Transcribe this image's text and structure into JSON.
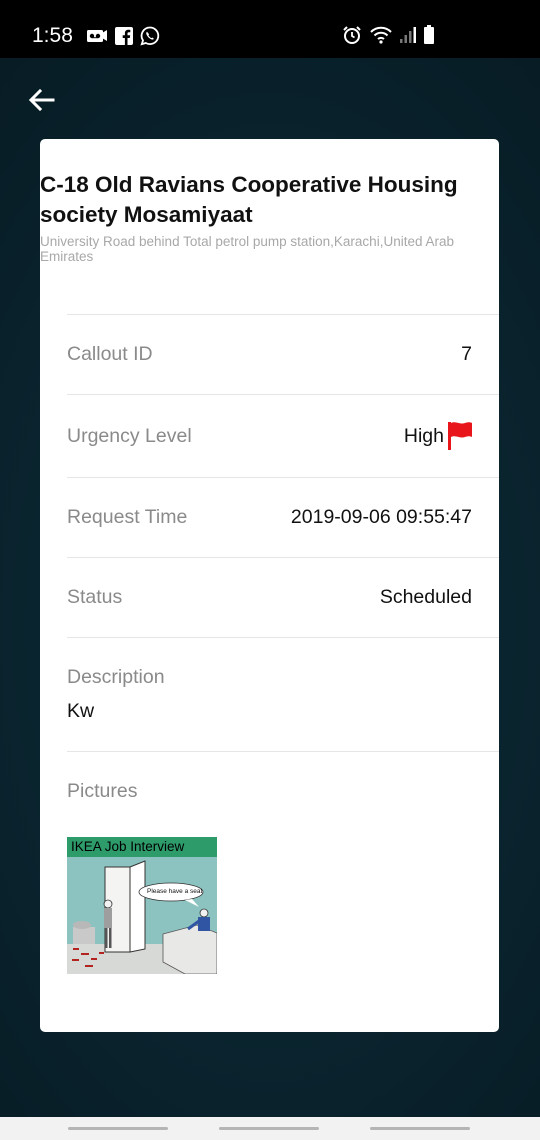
{
  "status_bar": {
    "time": "1:58",
    "left_icons": [
      "voicemail-icon",
      "facebook-icon",
      "whatsapp-icon"
    ],
    "right_icons": [
      "alarm-icon",
      "wifi-icon",
      "signal-icon",
      "battery-icon"
    ]
  },
  "header": {
    "back_icon": "arrow-left-icon"
  },
  "callout": {
    "title": "C-18 Old Ravians Cooperative Housing society Mosamiyaat",
    "address": "University Road behind Total petrol pump station,Karachi,United Arab Emirates",
    "rows": {
      "callout_id": {
        "label": "Callout ID",
        "value": "7"
      },
      "urgency": {
        "label": "Urgency Level",
        "value": "High",
        "flag_color": "#e8151b"
      },
      "request_time": {
        "label": "Request Time",
        "value": "2019-09-06 09:55:47"
      },
      "status": {
        "label": "Status",
        "value": "Scheduled"
      }
    },
    "description": {
      "label": "Description",
      "value": "Kw"
    },
    "pictures": {
      "label": "Pictures",
      "thumbnail_caption": "IKEA Job Interview",
      "thumbnail_speech": "Please have a seat"
    }
  },
  "colors": {
    "background": "#0a2530",
    "card": "#ffffff",
    "label_gray": "#8a8a8a",
    "flag_red": "#e8151b",
    "thumbnail_green": "#2e9b6b"
  }
}
